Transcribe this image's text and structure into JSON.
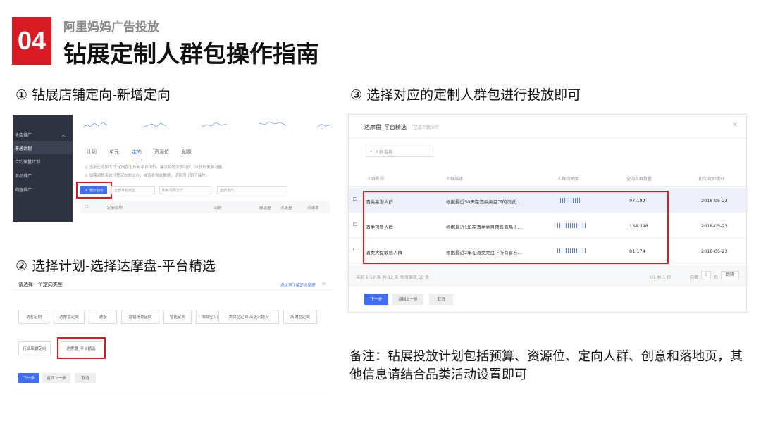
{
  "header": {
    "number": "04",
    "subtitle": "阿里妈妈广告投放",
    "title": "钻展定制人群包操作指南"
  },
  "steps": {
    "s1": "① 钻展店铺定向-新增定向",
    "s2": "② 选择计划-选择达摩盘-平台精选",
    "s3": "③ 选择对应的定制人群包进行投放即可"
  },
  "panel1": {
    "sidebar": [
      "全店推广",
      "普通计划",
      "合约保量计划",
      "单品推广",
      "内容推广"
    ],
    "tabs": [
      "计划",
      "单元",
      "定向",
      "资源位",
      "创意"
    ],
    "tip1": "当前已添加 5 个定向在于所有平台出价，建议及时添加出价，以获取更多流量。",
    "tip2": "如需调整系统托管定向的出价，或查看相关数据，请到顶计划下操作。",
    "add_btn": "+ 增加定向",
    "sel1": "全部计划类型",
    "sel2": "所有付费方式",
    "sel3": "全部定向",
    "col_name": "定向名称",
    "col_bid": "出价",
    "col_show": "展现量",
    "col_click": "点击量",
    "col_ctr": "点击率"
  },
  "panel2": {
    "title": "请选择一个定向类型",
    "link": "点这里了解定向原理",
    "close": "✕",
    "options_row1": [
      "访客定向",
      "达摩盘定向",
      "通投",
      "营销场景定向",
      "智能定向",
      "相似宝贝定向",
      "类目型定向-高级兴趣点",
      "店铺型定向"
    ],
    "options_row2": [
      "行业店铺定向",
      "达摩盘_平台精选"
    ],
    "next": "下一步",
    "back": "返回上一步",
    "cancel": "取消"
  },
  "panel3": {
    "title": "达摩盘_平台精选",
    "selected": "已选个数:0个",
    "close": "✕",
    "search_placeholder": "人群名称",
    "cols": [
      "人群名称",
      "人群描述",
      "人群相关度",
      "全网人群数量",
      "初次同步时间"
    ],
    "rows": [
      {
        "name": "酒类高潜人群",
        "desc": "根据最近30天在酒类类目下的浏览…",
        "count": "97,182",
        "date": "2018-05-23"
      },
      {
        "name": "酒类预售人群",
        "desc": "根据最近1年在酒类类目预售商品上…",
        "count": "134,398",
        "date": "2018-05-23"
      },
      {
        "name": "酒类大促敏感人群",
        "desc": "根据最近2年在酒类类目下所有官方…",
        "count": "81,174",
        "date": "2018-05-23"
      }
    ],
    "footer_info": "当前 1-12 条   共 12 条   每页展现 50 条",
    "page_info": "1/1   共 1 页",
    "goto_label": "向第",
    "goto_value": "1",
    "goto_unit": "页",
    "goto_btn": "跳转",
    "next": "下一步",
    "back": "返回上一步",
    "cancel": "取消"
  },
  "note": "备注：钻展投放计划包括预算、资源位、定向人群、创意和落地页，其他信息请结合品类活动设置即可"
}
